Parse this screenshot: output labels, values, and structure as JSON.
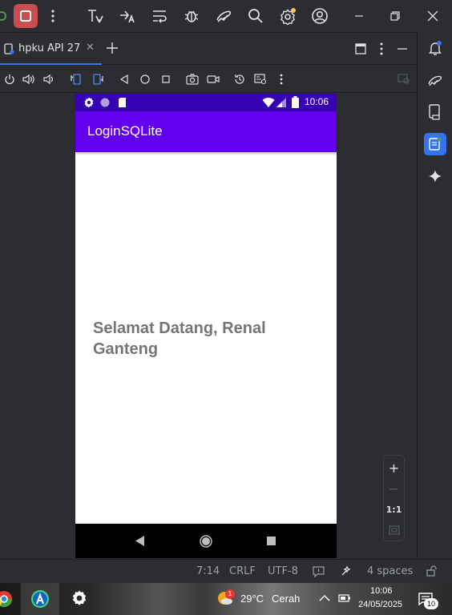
{
  "tab": {
    "label": "hpku API 27",
    "close": "✕"
  },
  "device": {
    "status_time": "10:06",
    "app_title": "LoginSQLite",
    "welcome_text": "Selamat Datang, Renal Ganteng"
  },
  "zoom": {
    "plus": "+",
    "minus": "−",
    "one_to_one": "1:1"
  },
  "status": {
    "position": "7:14",
    "line_ending": "CRLF",
    "encoding": "UTF-8",
    "indent": "4 spaces"
  },
  "taskbar": {
    "weather_temp": "29°C",
    "weather_desc": "Cerah",
    "weather_badge": "1",
    "clock_time": "10:06",
    "clock_date": "24/05/2025",
    "notif_count": "10"
  },
  "colors": {
    "accent": "#3574f0",
    "stop": "#c94f4f",
    "app_bar": "#6200ee",
    "status_bar": "#3700b3"
  }
}
